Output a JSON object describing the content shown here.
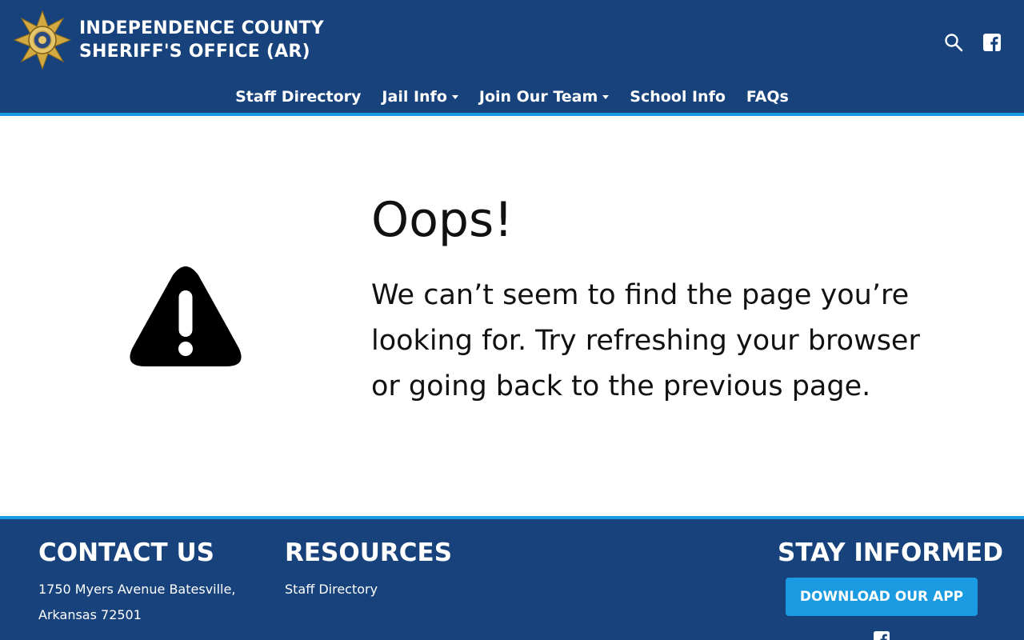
{
  "header": {
    "org_name_line1": "INDEPENDENCE COUNTY",
    "org_name_line2": "SHERIFF'S OFFICE (AR)",
    "badge_icon": "sheriff-star-badge-icon",
    "search_icon": "search-icon",
    "facebook_icon": "facebook-icon"
  },
  "nav": {
    "items": [
      {
        "label": "Staff Directory",
        "has_dropdown": false
      },
      {
        "label": "Jail Info",
        "has_dropdown": true
      },
      {
        "label": "Join Our Team",
        "has_dropdown": true
      },
      {
        "label": "School Info",
        "has_dropdown": false
      },
      {
        "label": "FAQs",
        "has_dropdown": false
      }
    ]
  },
  "error": {
    "title": "Oops!",
    "message": "We can’t seem to find the page you’re looking for. Try refreshing your browser or going back to the previous page.",
    "icon": "warning-triangle-icon"
  },
  "footer": {
    "contact": {
      "heading": "CONTACT US",
      "address_line1": "1750 Myers Avenue Batesville,",
      "address_line2": "Arkansas 72501"
    },
    "resources": {
      "heading": "RESOURCES",
      "links": [
        "Staff Directory"
      ]
    },
    "stay_informed": {
      "heading": "STAY INFORMED",
      "app_button": "DOWNLOAD OUR APP"
    }
  },
  "colors": {
    "header_bg": "#17427c",
    "accent": "#1a9ae0",
    "text_dark": "#111111",
    "white": "#ffffff"
  }
}
